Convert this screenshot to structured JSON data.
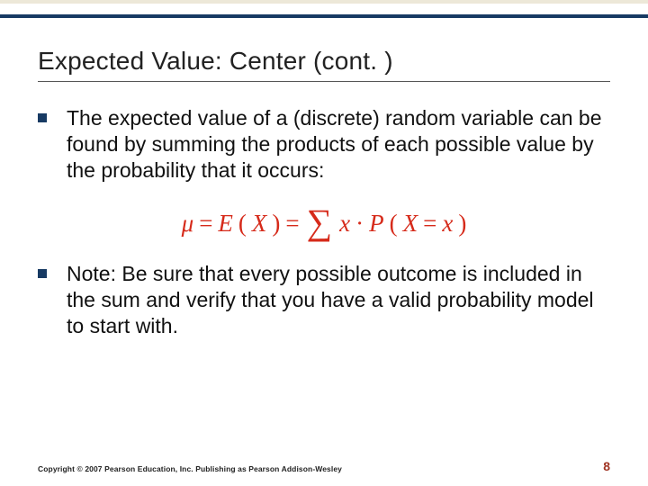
{
  "slide": {
    "title": "Expected Value: Center (cont. )",
    "bullets": [
      "The expected value of a (discrete) random variable can be found by summing the products of each possible value by the probability that it occurs:",
      "Note: Be sure that every possible outcome is included in the sum and verify that you have a valid probability model to start with."
    ],
    "formula": {
      "mu": "μ",
      "eq1": "=",
      "E": "E",
      "lp1": "(",
      "X1": "X",
      "rp1": ")",
      "eq2": "=",
      "sigma": "∑",
      "x": "x",
      "cdot": "·",
      "P": "P",
      "lp2": "(",
      "X2": "X",
      "eq3": "=",
      "x2": "x",
      "rp2": ")"
    },
    "copyright": "Copyright © 2007 Pearson Education, Inc. Publishing as Pearson Addison-Wesley",
    "page": "8"
  }
}
